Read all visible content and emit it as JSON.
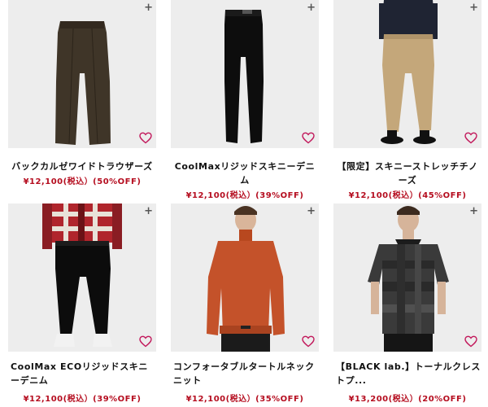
{
  "products": [
    {
      "name": "バックカルゼワイドトラウザーズ",
      "price": "¥12,100(税込）(50%OFF)",
      "image": "brown-trousers"
    },
    {
      "name": "CoolMaxリジッドスキニーデニム",
      "price": "¥12,100(税込）(39%OFF)",
      "image": "black-skinny-denim"
    },
    {
      "name": "【限定】スキニーストレッチチノーズ",
      "price": "¥12,100(税込）(45%OFF)",
      "image": "model-beige-chinos"
    },
    {
      "name": "CoolMax ECOリジッドスキニーデニム",
      "price": "¥12,100(税込）(39%OFF)",
      "image": "model-black-denim"
    },
    {
      "name": "コンフォータブルタートルネックニット",
      "price": "¥12,100(税込）(35%OFF)",
      "image": "model-orange-turtleneck"
    },
    {
      "name": "【BLACK lab.】トーナルクレストプ...",
      "price": "¥13,200(税込）(20%OFF)",
      "image": "model-grey-polo"
    }
  ],
  "icons": {
    "add": "plus-icon",
    "favorite": "heart-icon"
  },
  "colors": {
    "price": "#b50d1f",
    "heart": "#c2185b",
    "image_bg": "#ededed"
  }
}
